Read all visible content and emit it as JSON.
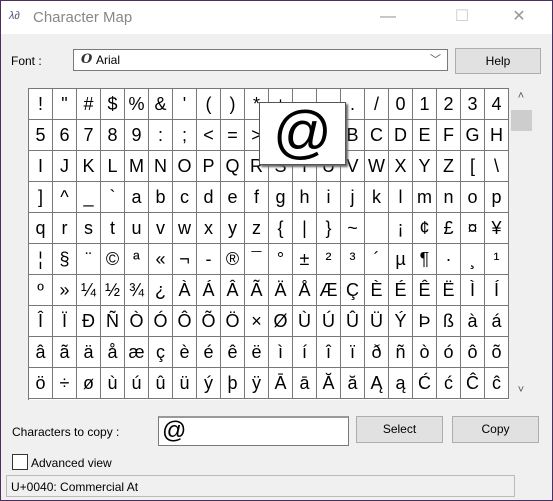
{
  "window": {
    "title": "Character Map",
    "minimize": "—",
    "maximize": "☐",
    "close": "✕",
    "icon": "charmap-icon"
  },
  "font": {
    "label": "Font :",
    "value": "Arial",
    "glyph": "O"
  },
  "help_label": "Help",
  "grid": {
    "rows": [
      [
        "!",
        "\"",
        "#",
        "$",
        "%",
        "&",
        "'",
        "(",
        ")",
        "*",
        "+",
        ",",
        "-",
        ".",
        "/",
        "0",
        "1",
        "2",
        "3",
        "4"
      ],
      [
        "5",
        "6",
        "7",
        "8",
        "9",
        ":",
        ";",
        "<",
        "=",
        ">",
        "?",
        "@",
        "A",
        "B",
        "C",
        "D",
        "E",
        "F",
        "G",
        "H"
      ],
      [
        "I",
        "J",
        "K",
        "L",
        "M",
        "N",
        "O",
        "P",
        "Q",
        "R",
        "S",
        "T",
        "U",
        "V",
        "W",
        "X",
        "Y",
        "Z",
        "[",
        "\\"
      ],
      [
        "]",
        "^",
        "_",
        "`",
        "a",
        "b",
        "c",
        "d",
        "e",
        "f",
        "g",
        "h",
        "i",
        "j",
        "k",
        "l",
        "m",
        "n",
        "o",
        "p"
      ],
      [
        "q",
        "r",
        "s",
        "t",
        "u",
        "v",
        "w",
        "x",
        "y",
        "z",
        "{",
        "|",
        "}",
        "~",
        " ",
        "¡",
        "¢",
        "£",
        "¤",
        "¥"
      ],
      [
        "¦",
        "§",
        "¨",
        "©",
        "ª",
        "«",
        "¬",
        "-",
        "®",
        "¯",
        "°",
        "±",
        "²",
        "³",
        "´",
        "µ",
        "¶",
        "·",
        "¸",
        "¹"
      ],
      [
        "º",
        "»",
        "¼",
        "½",
        "¾",
        "¿",
        "À",
        "Á",
        "Â",
        "Ã",
        "Ä",
        "Å",
        "Æ",
        "Ç",
        "È",
        "É",
        "Ê",
        "Ë",
        "Ì",
        "Í"
      ],
      [
        "Î",
        "Ï",
        "Ð",
        "Ñ",
        "Ò",
        "Ó",
        "Ô",
        "Õ",
        "Ö",
        "×",
        "Ø",
        "Ù",
        "Ú",
        "Û",
        "Ü",
        "Ý",
        "Þ",
        "ß",
        "à",
        "á"
      ],
      [
        "â",
        "ã",
        "ä",
        "å",
        "æ",
        "ç",
        "è",
        "é",
        "ê",
        "ë",
        "ì",
        "í",
        "î",
        "ï",
        "ð",
        "ñ",
        "ò",
        "ó",
        "ô",
        "õ"
      ],
      [
        "ö",
        "÷",
        "ø",
        "ù",
        "ú",
        "û",
        "ü",
        "ý",
        "þ",
        "ÿ",
        "Ā",
        "ā",
        "Ă",
        "ă",
        "Ą",
        "ą",
        "Ć",
        "ć",
        "Ĉ",
        "ĉ"
      ]
    ],
    "selected": "@"
  },
  "scroll": {
    "up": "˄",
    "down": "˅"
  },
  "copy": {
    "label": "Characters to copy :",
    "value": "@",
    "select_label": "Select",
    "copy_label": "Copy"
  },
  "advanced": {
    "label": "Advanced view",
    "checked": false
  },
  "status": "U+0040: Commercial At"
}
